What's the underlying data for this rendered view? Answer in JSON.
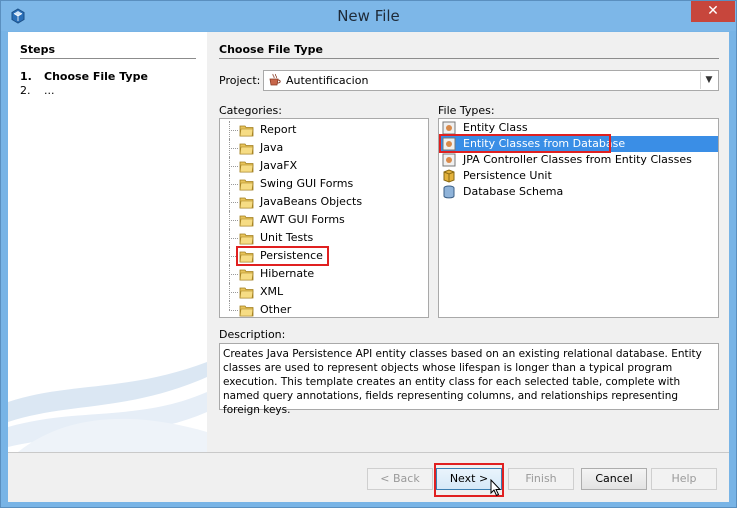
{
  "window": {
    "title": "New File",
    "close_symbol": "✕"
  },
  "steps": {
    "title": "Steps",
    "items": [
      {
        "num": "1.",
        "label": "Choose File Type"
      },
      {
        "num": "2.",
        "label": "..."
      }
    ]
  },
  "main": {
    "title": "Choose File Type",
    "project_label": "Project:",
    "project_value": "Autentificacion",
    "categories_label": "Categories:",
    "categories": [
      "Report",
      "Java",
      "JavaFX",
      "Swing GUI Forms",
      "JavaBeans Objects",
      "AWT GUI Forms",
      "Unit Tests",
      "Persistence",
      "Hibernate",
      "XML",
      "Other"
    ],
    "file_types_label": "File Types:",
    "file_types": [
      "Entity Class",
      "Entity Classes from Database",
      "JPA Controller Classes from Entity Classes",
      "Persistence Unit",
      "Database Schema"
    ],
    "description_label": "Description:",
    "description": "Creates Java Persistence API entity classes based on an existing relational database. Entity classes are used to represent objects whose lifespan is longer than a typical program execution. This template creates an entity class for each selected table, complete with named query annotations, fields representing columns, and relationships representing foreign keys."
  },
  "buttons": {
    "back": "< Back",
    "next": "Next >",
    "finish": "Finish",
    "cancel": "Cancel",
    "help": "Help"
  }
}
